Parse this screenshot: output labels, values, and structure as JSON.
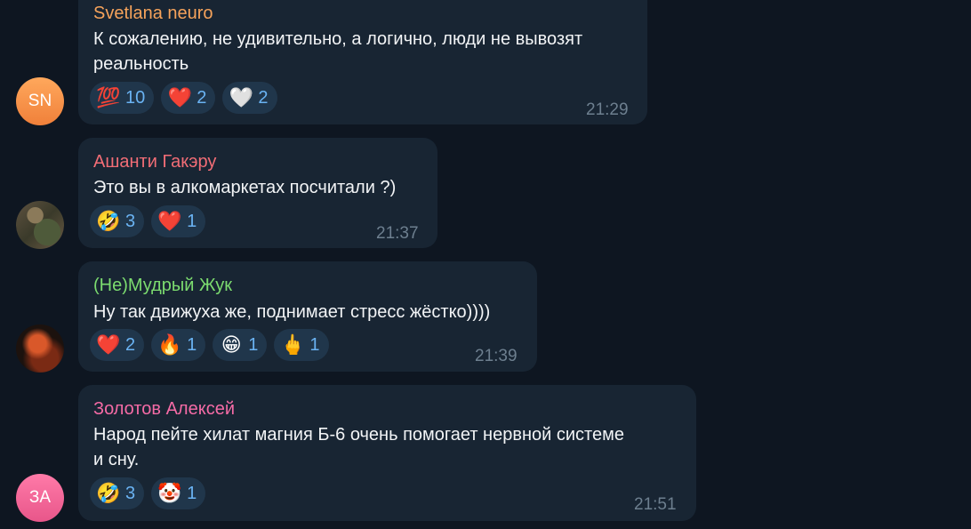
{
  "messages": [
    {
      "author": "Svetlana neuro",
      "author_color": "#f6a35b",
      "avatar_initials": "SN",
      "lines": [
        "К сожалению, не удивительно, а логично, люди не вывозят",
        "реальность"
      ],
      "reactions": [
        {
          "emoji": "💯",
          "icon": "hundred-points-icon",
          "count": "10"
        },
        {
          "emoji": "❤️",
          "icon": "red-heart-icon",
          "count": "2"
        },
        {
          "emoji": "🤍",
          "icon": "white-heart-icon",
          "count": "2"
        }
      ],
      "time": "21:29"
    },
    {
      "author": "Ашанти Гакэру",
      "author_color": "#f26d76",
      "avatar_initials": "",
      "lines": [
        "Это вы в алкомаркетах посчитали ?)"
      ],
      "reactions": [
        {
          "emoji": "🤣",
          "icon": "rofl-icon",
          "count": "3"
        },
        {
          "emoji": "❤️",
          "icon": "red-heart-icon",
          "count": "1"
        }
      ],
      "time": "21:37"
    },
    {
      "author": "(Не)Мудрый Жук",
      "author_color": "#7cdc6f",
      "avatar_initials": "",
      "lines": [
        "Ну так движуха же, поднимает стресс жёстко))))"
      ],
      "reactions": [
        {
          "emoji": "❤️",
          "icon": "red-heart-icon",
          "count": "2"
        },
        {
          "emoji": "🔥",
          "icon": "fire-icon",
          "count": "1"
        },
        {
          "emoji": "😁",
          "icon": "grinning-face-icon",
          "count": "1"
        },
        {
          "emoji": "🖕",
          "icon": "middle-finger-icon",
          "count": "1"
        }
      ],
      "time": "21:39"
    },
    {
      "author": "Золотов Алексей",
      "author_color": "#f56ba6",
      "avatar_initials": "ЗА",
      "lines": [
        "Народ пейте хилат магния Б-6 очень помогает нервной системе",
        "и сну."
      ],
      "reactions": [
        {
          "emoji": "🤣",
          "icon": "rofl-icon",
          "count": "3"
        },
        {
          "emoji": "🤡",
          "icon": "clown-face-icon",
          "count": "1"
        }
      ],
      "time": "21:51"
    }
  ]
}
